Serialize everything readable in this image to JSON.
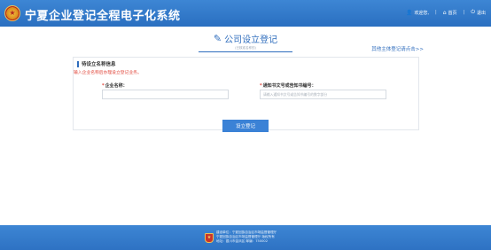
{
  "header": {
    "title": "宁夏企业登记全程电子化系统",
    "welcome": "欢迎您,",
    "home": "首页",
    "logout": "退出"
  },
  "main": {
    "page_title": "公司设立登记",
    "page_subtitle": "(已核准名称的)",
    "other_link": "其他主体登记请点击>>",
    "section_title": "待设立名称信息",
    "hint": "输入企业名称后办理设立登记业务。",
    "fields": {
      "company_name": {
        "label": "企业名称：",
        "value": ""
      },
      "notice_no": {
        "label": "通知书文号或告知书编号：",
        "placeholder": "请输入通知书文号或告知书编号的数字部分"
      }
    },
    "submit_label": "设立登记"
  },
  "footer": {
    "line1": "建设单位：宁夏回族自治区市场监督管理厅",
    "line2": "宁夏回族自治区市场监督管理厅 版权所有",
    "line3": "地址：银川市金凤区 邮编：750002"
  },
  "colors": {
    "primary": "#2f6dbd",
    "header_bg": "#3d86d4",
    "button": "#3b82d6",
    "required": "#e0463a"
  },
  "icons": [
    "national-emblem-icon",
    "user-icon",
    "home-icon",
    "power-icon",
    "edit-icon",
    "badge-icon"
  ]
}
